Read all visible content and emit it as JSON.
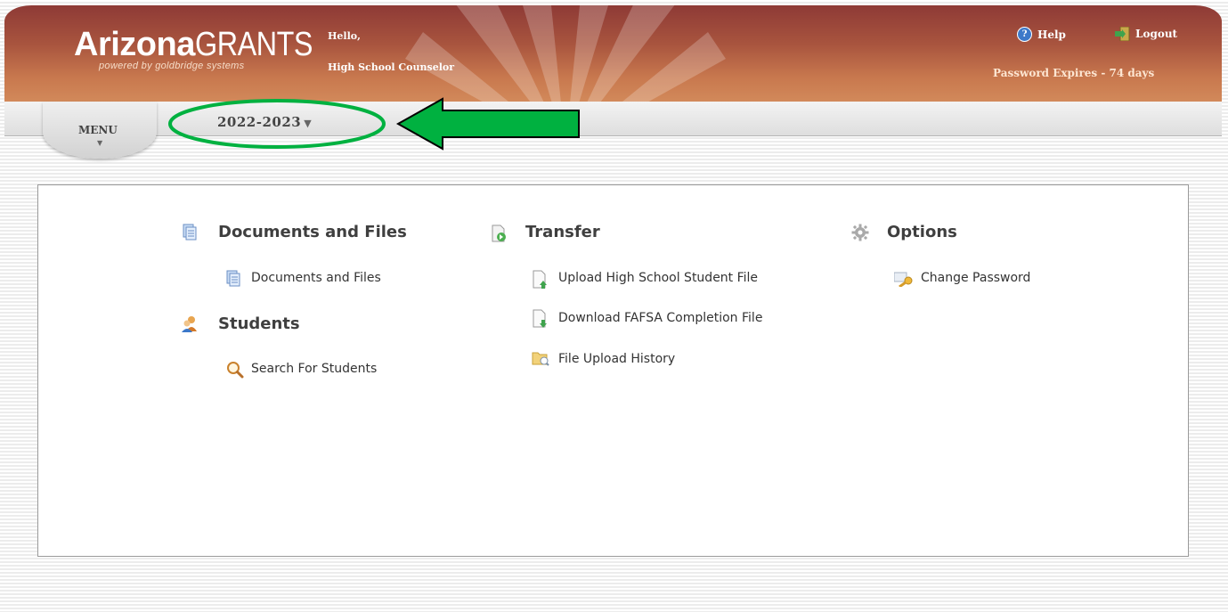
{
  "header": {
    "logo_bold": "Arizona",
    "logo_light": "GRANTS",
    "logo_tagline": "powered by goldbridge systems",
    "greeting": "Hello,",
    "user_role": "High School Counselor",
    "help_label": "Help",
    "logout_label": "Logout",
    "password_notice": "Password Expires - 74 days"
  },
  "nav": {
    "menu_label": "MENU",
    "year_selected": "2022-2023"
  },
  "sections": {
    "documents": {
      "title": "Documents and Files",
      "links": [
        "Documents and Files"
      ]
    },
    "students": {
      "title": "Students",
      "links": [
        "Search For Students"
      ]
    },
    "transfer": {
      "title": "Transfer",
      "links": [
        "Upload High School Student File",
        "Download FAFSA Completion File",
        "File Upload History"
      ]
    },
    "options": {
      "title": "Options",
      "links": [
        "Change Password"
      ]
    }
  },
  "colors": {
    "header_dark": "#8e3a36",
    "header_light": "#d2895a",
    "annotation_green": "#00b140",
    "link_text": "#333333"
  },
  "icons": {
    "documents": "documents-icon",
    "students": "people-icon",
    "transfer": "transfer-arrow-icon",
    "options": "gear-icon",
    "search": "magnifier-icon",
    "upload": "file-upload-icon",
    "download": "file-download-icon",
    "history": "folder-history-icon",
    "password": "key-icon"
  }
}
